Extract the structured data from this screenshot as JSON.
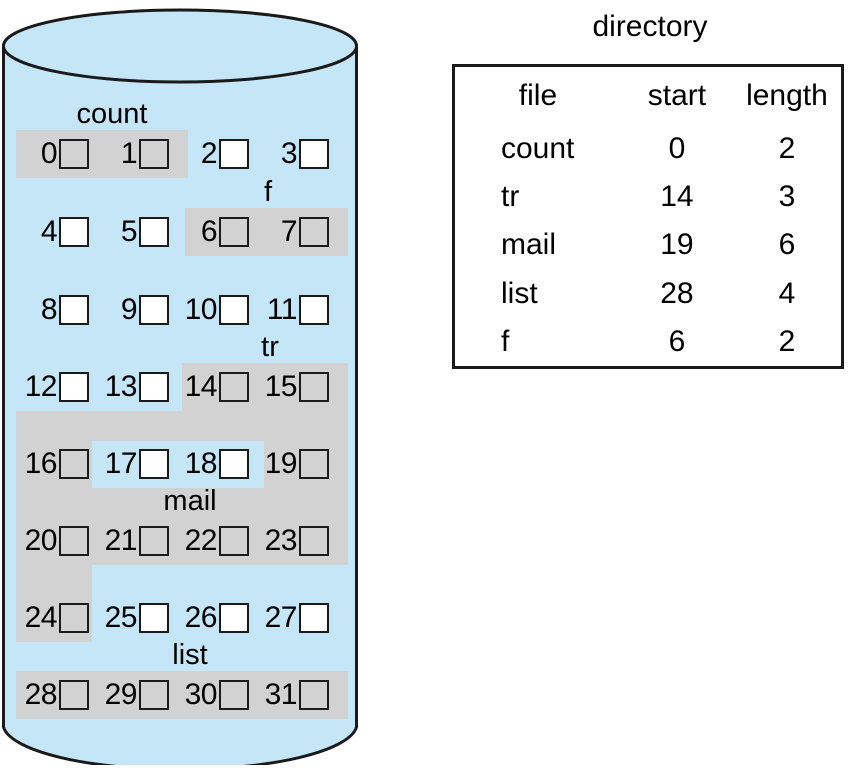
{
  "figure": {
    "disk_label": "disk",
    "colors": {
      "disk_fill": "#c5e6f7",
      "allocated_band": "#d2d2d2",
      "outline": "#1a1a1a",
      "free_block": "#ffffff"
    }
  },
  "disk": {
    "block_count": 32,
    "columns": 4,
    "rows": 8,
    "blocks": [
      {
        "id": "0",
        "allocated": true
      },
      {
        "id": "1",
        "allocated": true
      },
      {
        "id": "2",
        "allocated": false
      },
      {
        "id": "3",
        "allocated": false
      },
      {
        "id": "4",
        "allocated": false
      },
      {
        "id": "5",
        "allocated": false
      },
      {
        "id": "6",
        "allocated": true
      },
      {
        "id": "7",
        "allocated": true
      },
      {
        "id": "8",
        "allocated": false
      },
      {
        "id": "9",
        "allocated": false
      },
      {
        "id": "10",
        "allocated": false
      },
      {
        "id": "11",
        "allocated": false
      },
      {
        "id": "12",
        "allocated": false
      },
      {
        "id": "13",
        "allocated": false
      },
      {
        "id": "14",
        "allocated": true
      },
      {
        "id": "15",
        "allocated": true
      },
      {
        "id": "16",
        "allocated": true
      },
      {
        "id": "17",
        "allocated": false
      },
      {
        "id": "18",
        "allocated": false
      },
      {
        "id": "19",
        "allocated": true
      },
      {
        "id": "20",
        "allocated": true
      },
      {
        "id": "21",
        "allocated": true
      },
      {
        "id": "22",
        "allocated": true
      },
      {
        "id": "23",
        "allocated": true
      },
      {
        "id": "24",
        "allocated": true
      },
      {
        "id": "25",
        "allocated": false
      },
      {
        "id": "26",
        "allocated": false
      },
      {
        "id": "27",
        "allocated": false
      },
      {
        "id": "28",
        "allocated": true
      },
      {
        "id": "29",
        "allocated": true
      },
      {
        "id": "30",
        "allocated": true
      },
      {
        "id": "31",
        "allocated": true
      }
    ],
    "file_labels": [
      {
        "name": "count"
      },
      {
        "name": "f"
      },
      {
        "name": "tr"
      },
      {
        "name": "mail"
      },
      {
        "name": "list"
      }
    ]
  },
  "directory": {
    "title": "directory",
    "headers": {
      "file": "file",
      "start": "start",
      "length": "length"
    },
    "rows": [
      {
        "file": "count",
        "start": "0",
        "length": "2"
      },
      {
        "file": "tr",
        "start": "14",
        "length": "3"
      },
      {
        "file": "mail",
        "start": "19",
        "length": "6"
      },
      {
        "file": "list",
        "start": "28",
        "length": "4"
      },
      {
        "file": "f",
        "start": "6",
        "length": "2"
      }
    ]
  }
}
